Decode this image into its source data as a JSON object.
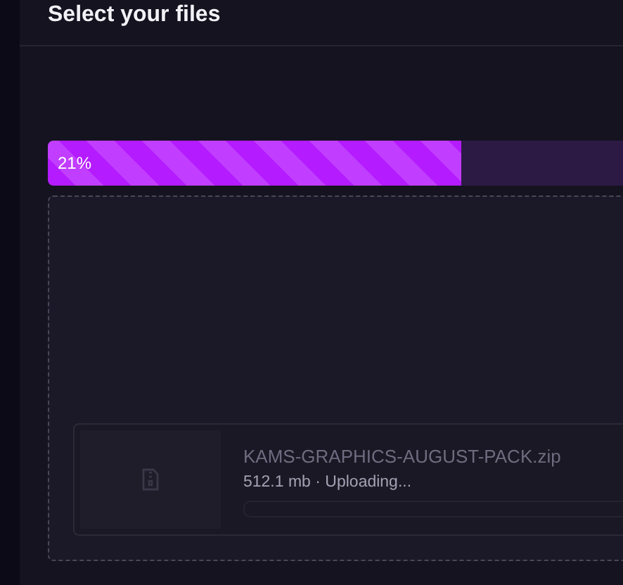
{
  "header": {
    "title": "Select your files"
  },
  "upload_progress": {
    "level": 0.21,
    "label": "21%"
  },
  "files": [
    {
      "name": "KAMS-GRAPHICS-AUGUST-PACK.zip",
      "details": "512.1 mb · Uploading..."
    }
  ]
}
